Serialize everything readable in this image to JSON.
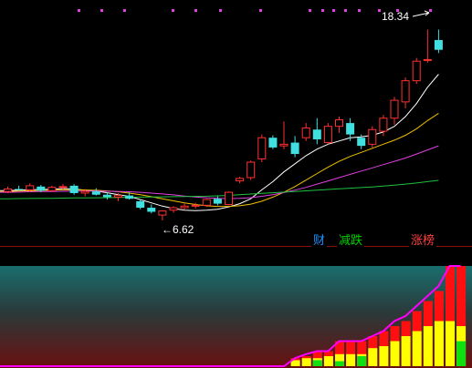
{
  "labels": {
    "high_price": "18.34",
    "low_price": "6.62",
    "tag_finance": "财",
    "tag_decline": "减跌",
    "tag_limitup": "涨榜"
  },
  "colors": {
    "up": "#ff3030",
    "down": "#40e0e0",
    "ma5": "#ffffff",
    "ma10": "#f0c000",
    "ma20": "#e040e0",
    "ma60": "#20c040",
    "indicator_red": "#ff1010",
    "indicator_yellow": "#ffff00",
    "indicator_green": "#10e010",
    "indicator_line": "#ff00ff"
  },
  "chart_data": [
    {
      "type": "candlestick",
      "price_range": [
        5.5,
        19.6
      ],
      "high_label": "18.34",
      "low_label": "6.62",
      "candles": [
        {
          "o": 8.4,
          "h": 8.7,
          "l": 8.3,
          "c": 8.55
        },
        {
          "o": 8.55,
          "h": 8.75,
          "l": 8.45,
          "c": 8.5
        },
        {
          "o": 8.5,
          "h": 8.9,
          "l": 8.35,
          "c": 8.75
        },
        {
          "o": 8.7,
          "h": 8.8,
          "l": 8.35,
          "c": 8.45
        },
        {
          "o": 8.45,
          "h": 8.75,
          "l": 8.4,
          "c": 8.65
        },
        {
          "o": 8.65,
          "h": 8.85,
          "l": 8.55,
          "c": 8.7
        },
        {
          "o": 8.75,
          "h": 8.85,
          "l": 8.2,
          "c": 8.3
        },
        {
          "o": 8.3,
          "h": 8.55,
          "l": 8.1,
          "c": 8.4
        },
        {
          "o": 8.4,
          "h": 8.6,
          "l": 8.15,
          "c": 8.2
        },
        {
          "o": 8.2,
          "h": 8.35,
          "l": 7.9,
          "c": 8.05
        },
        {
          "o": 8.05,
          "h": 8.3,
          "l": 7.8,
          "c": 8.15
        },
        {
          "o": 8.15,
          "h": 8.35,
          "l": 7.9,
          "c": 7.95
        },
        {
          "o": 7.8,
          "h": 7.9,
          "l": 7.3,
          "c": 7.4
        },
        {
          "o": 7.4,
          "h": 7.6,
          "l": 7.05,
          "c": 7.15
        },
        {
          "o": 6.95,
          "h": 7.25,
          "l": 6.62,
          "c": 7.2
        },
        {
          "o": 7.25,
          "h": 7.5,
          "l": 7.1,
          "c": 7.4
        },
        {
          "o": 7.4,
          "h": 7.7,
          "l": 7.3,
          "c": 7.5
        },
        {
          "o": 7.5,
          "h": 7.7,
          "l": 7.35,
          "c": 7.55
        },
        {
          "o": 7.55,
          "h": 7.95,
          "l": 7.45,
          "c": 7.9
        },
        {
          "o": 7.95,
          "h": 8.1,
          "l": 7.55,
          "c": 7.65
        },
        {
          "o": 7.6,
          "h": 8.4,
          "l": 7.55,
          "c": 8.35
        },
        {
          "o": 9.05,
          "h": 9.3,
          "l": 8.9,
          "c": 9.2
        },
        {
          "o": 9.25,
          "h": 10.3,
          "l": 9.1,
          "c": 10.2
        },
        {
          "o": 10.4,
          "h": 11.9,
          "l": 10.2,
          "c": 11.7
        },
        {
          "o": 11.7,
          "h": 11.85,
          "l": 11.0,
          "c": 11.1
        },
        {
          "o": 11.2,
          "h": 12.7,
          "l": 11.0,
          "c": 11.3
        },
        {
          "o": 11.4,
          "h": 11.8,
          "l": 10.5,
          "c": 10.7
        },
        {
          "o": 11.7,
          "h": 12.6,
          "l": 11.5,
          "c": 12.3
        },
        {
          "o": 12.2,
          "h": 12.9,
          "l": 11.3,
          "c": 11.6
        },
        {
          "o": 11.4,
          "h": 12.6,
          "l": 11.3,
          "c": 12.4
        },
        {
          "o": 12.4,
          "h": 13.0,
          "l": 12.0,
          "c": 12.8
        },
        {
          "o": 12.6,
          "h": 12.9,
          "l": 11.5,
          "c": 11.9
        },
        {
          "o": 11.7,
          "h": 11.9,
          "l": 11.0,
          "c": 11.2
        },
        {
          "o": 11.3,
          "h": 12.4,
          "l": 11.1,
          "c": 12.2
        },
        {
          "o": 12.1,
          "h": 13.1,
          "l": 11.8,
          "c": 12.9
        },
        {
          "o": 12.9,
          "h": 14.2,
          "l": 12.5,
          "c": 14.0
        },
        {
          "o": 13.9,
          "h": 15.4,
          "l": 13.5,
          "c": 15.2
        },
        {
          "o": 15.2,
          "h": 16.6,
          "l": 15.0,
          "c": 16.4
        },
        {
          "o": 16.5,
          "h": 18.34,
          "l": 16.3,
          "c": 16.5
        },
        {
          "o": 17.7,
          "h": 18.34,
          "l": 16.9,
          "c": 17.1
        }
      ],
      "moving_averages": [
        {
          "name": "MA5",
          "values": [
            8.45,
            8.48,
            8.5,
            8.52,
            8.53,
            8.58,
            8.55,
            8.48,
            8.42,
            8.32,
            8.2,
            8.1,
            7.9,
            7.7,
            7.5,
            7.35,
            7.25,
            7.22,
            7.25,
            7.3,
            7.45,
            7.65,
            7.95,
            8.5,
            9.0,
            9.6,
            10.1,
            10.6,
            11.0,
            11.3,
            11.5,
            11.7,
            11.75,
            11.85,
            12.05,
            12.4,
            13.0,
            13.8,
            14.8,
            15.6
          ]
        },
        {
          "name": "MA10",
          "values": [
            8.4,
            8.42,
            8.44,
            8.46,
            8.48,
            8.5,
            8.5,
            8.49,
            8.47,
            8.43,
            8.38,
            8.3,
            8.2,
            8.08,
            7.95,
            7.82,
            7.7,
            7.6,
            7.52,
            7.48,
            7.48,
            7.52,
            7.62,
            7.8,
            8.05,
            8.35,
            8.7,
            9.1,
            9.5,
            9.9,
            10.25,
            10.55,
            10.8,
            11.05,
            11.3,
            11.55,
            11.85,
            12.25,
            12.75,
            13.2
          ]
        },
        {
          "name": "MA20",
          "values": [
            8.35,
            8.36,
            8.38,
            8.39,
            8.4,
            8.41,
            8.42,
            8.42,
            8.42,
            8.41,
            8.4,
            8.38,
            8.35,
            8.3,
            8.25,
            8.19,
            8.12,
            8.06,
            8.01,
            7.98,
            7.97,
            7.98,
            8.02,
            8.1,
            8.2,
            8.33,
            8.48,
            8.65,
            8.85,
            9.05,
            9.25,
            9.45,
            9.65,
            9.85,
            10.05,
            10.25,
            10.45,
            10.7,
            10.95,
            11.2
          ]
        },
        {
          "name": "MA60",
          "values": [
            7.95,
            7.96,
            7.97,
            7.98,
            7.98,
            7.99,
            8.0,
            8.0,
            8.01,
            8.02,
            8.03,
            8.04,
            8.05,
            8.06,
            8.07,
            8.08,
            8.09,
            8.1,
            8.11,
            8.13,
            8.16,
            8.2,
            8.24,
            8.28,
            8.32,
            8.36,
            8.4,
            8.44,
            8.48,
            8.52,
            8.56,
            8.6,
            8.64,
            8.68,
            8.73,
            8.79,
            8.85,
            8.92,
            9.0,
            9.08
          ]
        }
      ]
    },
    {
      "type": "bar",
      "name": "indicator",
      "range": [
        0,
        100
      ],
      "start_index": 26,
      "red": [
        8,
        10,
        15,
        15,
        25,
        25,
        25,
        30,
        35,
        40,
        45,
        55,
        65,
        75,
        100,
        100
      ],
      "yellow": [
        6,
        8,
        8,
        10,
        12,
        12,
        12,
        18,
        20,
        25,
        30,
        35,
        40,
        45,
        45,
        40
      ],
      "green": [
        0,
        0,
        6,
        0,
        5,
        0,
        10,
        0,
        0,
        0,
        0,
        0,
        0,
        0,
        0,
        25
      ],
      "line": [
        8,
        12,
        15,
        15,
        25,
        25,
        25,
        30,
        35,
        45,
        50,
        60,
        70,
        80,
        100,
        100
      ]
    }
  ]
}
